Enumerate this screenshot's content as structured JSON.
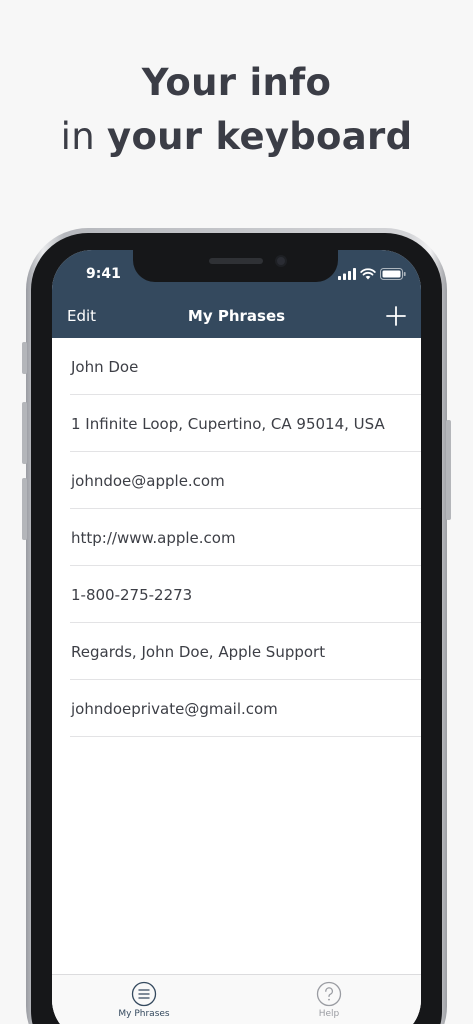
{
  "headline": {
    "line1": "Your info",
    "line2_prefix": "in ",
    "line2_bold": "your keyboard"
  },
  "status_bar": {
    "time": "9:41"
  },
  "nav": {
    "edit_label": "Edit",
    "title": "My Phrases",
    "add_icon": "plus-icon"
  },
  "phrases": [
    "John Doe",
    "1 Infinite Loop, Cupertino, CA 95014, USA",
    "johndoe@apple.com",
    "http://www.apple.com",
    "1-800-275-2273",
    "Regards, John Doe, Apple Support",
    "johndoeprivate@gmail.com"
  ],
  "tabbar": {
    "tabs": [
      {
        "label": "My Phrases",
        "icon": "list-icon",
        "selected": true
      },
      {
        "label": "Help",
        "icon": "question-icon",
        "selected": false
      }
    ]
  },
  "colors": {
    "nav_background": "#34495e",
    "headline_text": "#3b3d46",
    "tab_inactive": "#9a9ca2"
  }
}
